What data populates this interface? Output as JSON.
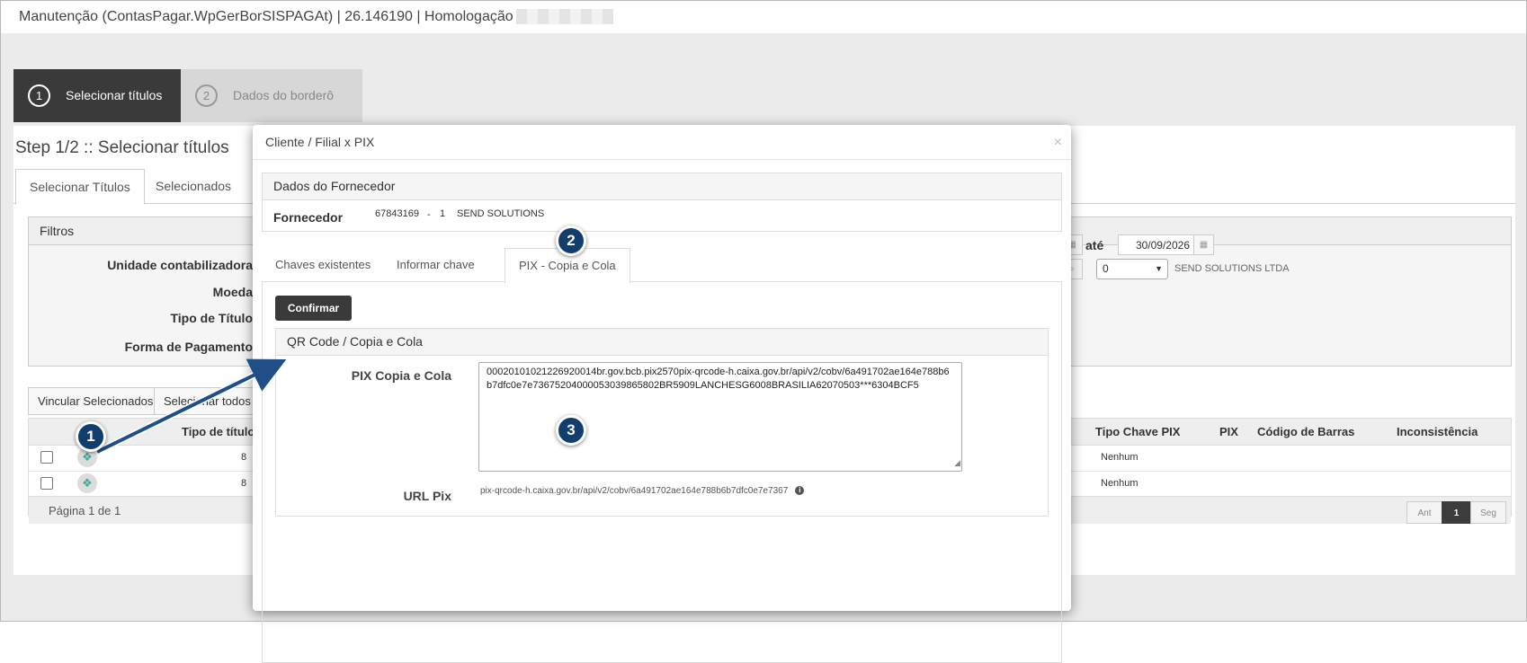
{
  "window": {
    "title": "Manutenção (ContasPagar.WpGerBorSISPAGAt) | 26.146190 | Homologação |"
  },
  "wizard": {
    "steps": [
      {
        "num": "1",
        "label": "Selecionar títulos"
      },
      {
        "num": "2",
        "label": "Dados do borderô"
      }
    ],
    "page_title": "Step 1/2 :: Selecionar títulos"
  },
  "tabs": [
    "Selecionar Títulos",
    "Selecionados"
  ],
  "filters": {
    "title": "Filtros",
    "labels": [
      "Unidade contabilizadora",
      "Moeda",
      "Tipo de Título",
      "Forma de Pagamento"
    ],
    "date_to_label": "até",
    "date_to_value": "30/09/2026",
    "select_value": "0",
    "supplier_name": "SEND SOLUTIONS LTDA"
  },
  "actions": {
    "link_selected": "Vincular Selecionados",
    "select_all": "Selecionar todos"
  },
  "table": {
    "headers": {
      "tipo_titulo": "Tipo de título",
      "tipo_chave_pix": "Tipo Chave PIX",
      "pix": "PIX",
      "codigo_barras": "Código de Barras",
      "inconsistencia": "Inconsistência"
    },
    "rows": [
      {
        "tipo_titulo": "8",
        "tipo_chave_pix": "Nenhum"
      },
      {
        "tipo_titulo": "8",
        "tipo_chave_pix": "Nenhum"
      }
    ],
    "page_info": "Página 1 de 1",
    "pager": {
      "prev": "Ant",
      "current": "1",
      "next": "Seg"
    }
  },
  "modal": {
    "title": "Cliente / Filial x PIX",
    "close": "×",
    "supplier_box_title": "Dados do Fornecedor",
    "supplier_label": "Fornecedor",
    "supplier_code": "67843169",
    "supplier_sep": "-",
    "supplier_branch": "1",
    "supplier_name": "SEND SOLUTIONS",
    "tabs": [
      "Chaves existentes",
      "Informar chave",
      "PIX - Copia e Cola"
    ],
    "confirm_label": "Confirmar",
    "qr_box_title": "QR Code / Copia e Cola",
    "pix_label": "PIX Copia e Cola",
    "pix_value": "00020101021226920014br.gov.bcb.pix2570pix-qrcode-h.caixa.gov.br/api/v2/cobv/6a491702ae164e788b6b7dfc0e7e73675204000053039865802BR5909LANCHESG6008BRASILIA62070503***6304BCF5",
    "url_label": "URL Pix",
    "url_value": "pix-qrcode-h.caixa.gov.br/api/v2/cobv/6a491702ae164e788b6b7dfc0e7e7367"
  },
  "annotations": [
    "1",
    "2",
    "3"
  ],
  "colors": {
    "step_active": "#3a3a3a",
    "badge": "#123e6e",
    "arrow": "#1f4f86",
    "clover": "#3ba99c"
  }
}
